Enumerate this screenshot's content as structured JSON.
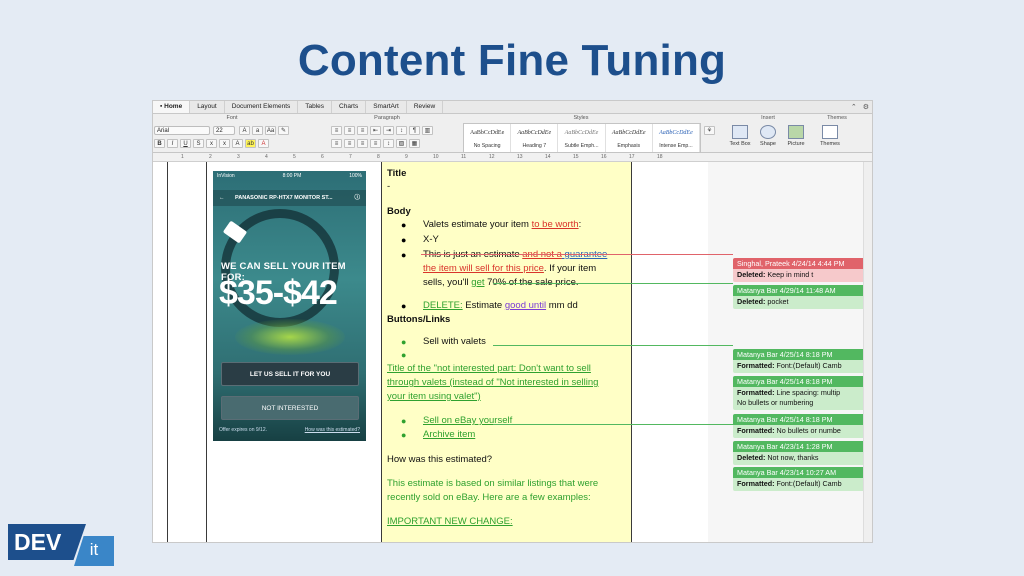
{
  "slide": {
    "title": "Content Fine Tuning"
  },
  "logo": {
    "dev": "DEV",
    "it": "it"
  },
  "word": {
    "tabs": [
      "Home",
      "Layout",
      "Document Elements",
      "Tables",
      "Charts",
      "SmartArt",
      "Review"
    ],
    "ribbon_groups": {
      "font": "Font",
      "paragraph": "Paragraph",
      "styles": "Styles",
      "insert": "Insert",
      "themes": "Themes"
    },
    "font_name": "Arial",
    "font_size": "22",
    "styles": [
      {
        "sample": "AaBbCcDdEe",
        "name": "No Spacing"
      },
      {
        "sample": "AaBbCcDdEe",
        "name": "Heading 7"
      },
      {
        "sample": "AaBbCcDdEe",
        "name": "Subtle Emph..."
      },
      {
        "sample": "AaBbCcDdEe",
        "name": "Emphasis"
      },
      {
        "sample": "AaBbCcDdEe",
        "name": "Intense Emp..."
      }
    ],
    "insert_buttons": [
      "Text Box",
      "Shape",
      "Picture"
    ],
    "themes_button": "Themes",
    "ruler_ticks": [
      "1",
      "2",
      "3",
      "4",
      "5",
      "6",
      "7",
      "8",
      "9",
      "10",
      "11",
      "12",
      "13",
      "14",
      "15",
      "16",
      "17",
      "18"
    ]
  },
  "phone": {
    "carrier": "InVision",
    "time": "8:00 PM",
    "battery": "100%",
    "header": "PANASONIC RP-HTX7 MONITOR ST...",
    "sell_text": "WE CAN SELL YOUR ITEM FOR:",
    "price": "$35-$42",
    "btn_sell": "LET US SELL IT FOR YOU",
    "btn_not": "NOT INTERESTED",
    "offer": "Offer expires on 9/12.",
    "estimated_link": "How was this estimated?"
  },
  "doc": {
    "title": "Title",
    "dash": "-",
    "body": "Body",
    "b1_pre": "Valets estimate your item ",
    "b1_red": "to be worth",
    "b1_post": ":",
    "b2": "X-Y",
    "b3_pre": "This is just an estimate ",
    "b3_red1": "and not a",
    "b3_red2": " guarantee",
    "b3_line2_red": "the item will sell for this price",
    "b3_line2_post": ". If your item",
    "b3_line3_pre": "sells, you'll ",
    "b3_line3_green": "get",
    "b3_line3_post": " 70% of the sale price.",
    "b4_green": "DELETE:",
    "b4_mid": " Estimate ",
    "b4_purple": "good until",
    "b4_post": " mm dd",
    "buttons_links": "Buttons/Links",
    "b5": "Sell with valets",
    "p_green1": "Title of the \"not interested part: Don't want to sell",
    "p_green2": "through valets (instead of \"Not interested in selling",
    "p_green3": "your item using valet\")",
    "b6": "Sell on eBay yourself",
    "b7": "Archive item",
    "q": "How was this estimated?",
    "p2_1": "This estimate is based on similar listings that were",
    "p2_2": "recently sold on eBay. Here are a few examples:",
    "important": "IMPORTANT NEW CHANGE:"
  },
  "comments": [
    {
      "header": "Singhal, Prateek 4/24/14 4:44 PM",
      "label": "Deleted:",
      "text": " Keep in mind t",
      "text2": "",
      "color": "#e0636a"
    },
    {
      "header": "Matanya Bar 4/29/14 11:48 AM",
      "label": "Deleted:",
      "text": " pocket",
      "text2": "",
      "color": "#52b860"
    },
    {
      "header": "Matanya Bar 4/25/14 8:18 PM",
      "label": "Formatted:",
      "text": " Font:(Default) Camb",
      "text2": "",
      "color": "#52b860"
    },
    {
      "header": "Matanya Bar 4/25/14 8:18 PM",
      "label": "Formatted:",
      "text": " Line spacing:  multip",
      "text2": "No bullets or numbering",
      "color": "#52b860"
    },
    {
      "header": "Matanya Bar 4/25/14 8:18 PM",
      "label": "Formatted:",
      "text": "  No bullets or numbe",
      "text2": "",
      "color": "#52b860"
    },
    {
      "header": "Matanya Bar 4/23/14 1:28 PM",
      "label": "Deleted:",
      "text": " Not now, thanks",
      "text2": "",
      "color": "#52b860"
    },
    {
      "header": "Matanya Bar 4/23/14 10:27 AM",
      "label": "Formatted:",
      "text": " Font:(Default) Camb",
      "text2": "",
      "color": "#52b860"
    }
  ]
}
